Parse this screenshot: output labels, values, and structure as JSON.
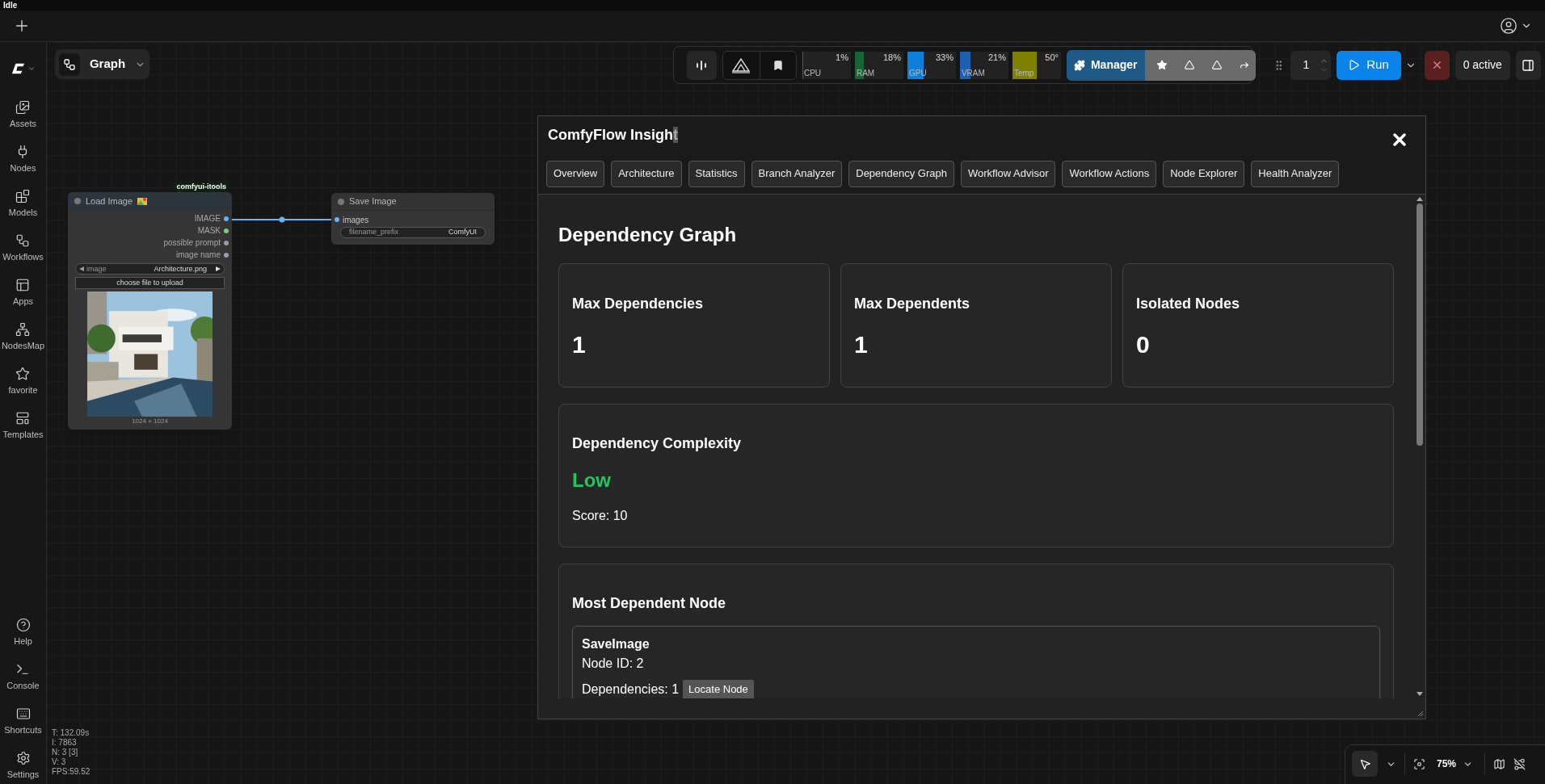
{
  "status": "Idle",
  "sidebar": {
    "items": [
      {
        "label": "Assets"
      },
      {
        "label": "Nodes"
      },
      {
        "label": "Models"
      },
      {
        "label": "Workflows"
      },
      {
        "label": "Apps"
      },
      {
        "label": "NodesMap"
      },
      {
        "label": "favorite"
      },
      {
        "label": "Templates"
      }
    ],
    "bottom_items": [
      {
        "label": "Help"
      },
      {
        "label": "Console"
      },
      {
        "label": "Shortcuts"
      },
      {
        "label": "Settings"
      }
    ]
  },
  "graph_button": {
    "label": "Graph"
  },
  "toolbar": {
    "meters": [
      {
        "label": "CPU",
        "reading": "1%",
        "level": 0.01,
        "color": "#15803d"
      },
      {
        "label": "RAM",
        "reading": "18%",
        "level": 0.18,
        "color": "#166534"
      },
      {
        "label": "GPU",
        "reading": "33%",
        "level": 0.33,
        "color": "#0b7fd9"
      },
      {
        "label": "VRAM",
        "reading": "21%",
        "level": 0.21,
        "color": "#1d5fb0"
      },
      {
        "label": "Temp",
        "reading": "50°",
        "level": 0.5,
        "color": "#808000"
      }
    ],
    "manager": "Manager",
    "queue_count": "1",
    "run": "Run",
    "active": "0 active"
  },
  "canvas": {
    "nodes": [
      {
        "kind": "load",
        "title": "Load Image",
        "badge": "comfyui-itools",
        "outputs": [
          {
            "label": "IMAGE",
            "color": "#64b5f6"
          },
          {
            "label": "MASK",
            "color": "#81c784"
          },
          {
            "label": "possible prompt",
            "color": "#9a9ab0"
          },
          {
            "label": "image name",
            "color": "#9a9ab0"
          }
        ],
        "combo": {
          "label": "image",
          "value": "Architecture.png"
        },
        "button": "choose file to upload",
        "image_size": "1024 × 1024"
      },
      {
        "kind": "save",
        "title": "Save Image",
        "inputs": [
          {
            "label": "images",
            "color": "#64b5f6"
          }
        ],
        "text_widget": {
          "label": "filename_prefix",
          "value": "ComfyUI"
        }
      }
    ]
  },
  "stats": [
    "T: 132.09s",
    "I: 7863",
    "N: 3 [3]",
    "V: 3",
    "FPS:59.52"
  ],
  "zoom_controls": {
    "zoom": "75%"
  },
  "panel": {
    "title": "ComfyFlow Insigh",
    "title_selection": "t",
    "tabs": [
      "Overview",
      "Architecture",
      "Statistics",
      "Branch Analyzer",
      "Dependency Graph",
      "Workflow Advisor",
      "Workflow Actions",
      "Node Explorer",
      "Health Analyzer"
    ],
    "heading": "Dependency Graph",
    "stat_cards": [
      {
        "label": "Max Dependencies",
        "value": "1"
      },
      {
        "label": "Max Dependents",
        "value": "1"
      },
      {
        "label": "Isolated Nodes",
        "value": "0"
      }
    ],
    "complexity": {
      "label": "Dependency Complexity",
      "value": "Low",
      "score": "Score: 10"
    },
    "most_dependent": {
      "heading": "Most Dependent Node",
      "name": "SaveImage",
      "node_id": "Node ID: 2",
      "dependencies": "Dependencies: 1",
      "button": "Locate Node"
    }
  }
}
